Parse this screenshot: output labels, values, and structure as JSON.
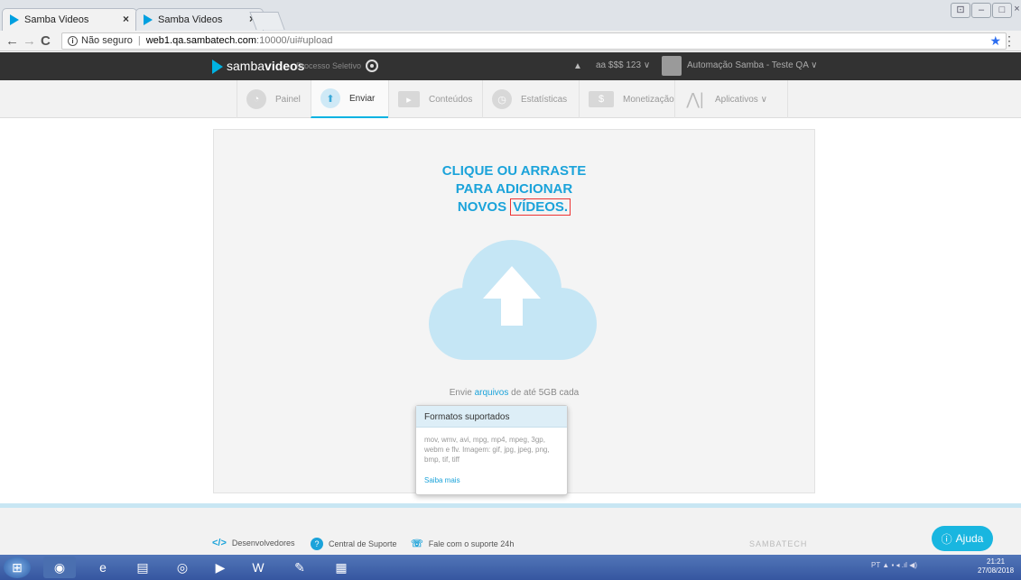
{
  "browser": {
    "tabs": [
      {
        "title": "Samba Videos",
        "close": "×"
      },
      {
        "title": "Samba Videos",
        "close": "×"
      }
    ],
    "secure_label": "Não seguro",
    "url_host": "web1.qa.sambatech.com",
    "url_path": ":10000/ui#upload"
  },
  "header": {
    "logo_light": "samba",
    "logo_bold": "videos",
    "process": "Processo Seletivo",
    "account": "aa $$$ 123 ∨",
    "user": "Automação Samba - Teste QA ∨"
  },
  "nav": [
    {
      "label": "Painel",
      "icon": "dashboard-icon"
    },
    {
      "label": "Enviar",
      "icon": "upload-icon"
    },
    {
      "label": "Conteúdos",
      "icon": "contents-icon"
    },
    {
      "label": "Estatísticas",
      "icon": "stats-icon"
    },
    {
      "label": "Monetização",
      "icon": "monetization-icon"
    },
    {
      "label": "Aplicativos ∨",
      "icon": "apps-icon"
    }
  ],
  "upload": {
    "line1": "CLIQUE OU ARRASTE",
    "line2": "PARA ADICIONAR",
    "line3a": "NOVOS",
    "line3b": "VÍDEOS.",
    "send_prefix": "Envie",
    "send_link": "arquivos",
    "send_suffix": "de até 5GB cada"
  },
  "popover": {
    "title": "Formatos suportados",
    "body": "mov, wmv, avi, mpg, mp4, mpeg, 3gp, webm e flv. Imagem: gif, jpg, jpeg, png, bmp, tif, tiff",
    "more": "Saiba mais"
  },
  "footer": {
    "dev": "Desenvolvedores",
    "support": "Central de Suporte",
    "phone": "Fale com o suporte 24h",
    "brand": "SAMBATECH",
    "help": "Ajuda"
  },
  "taskbar": {
    "lang": "PT",
    "time": "21:21",
    "date": "27/08/2018"
  },
  "colors": {
    "accent": "#1ba3da",
    "header_bg": "#323232"
  }
}
